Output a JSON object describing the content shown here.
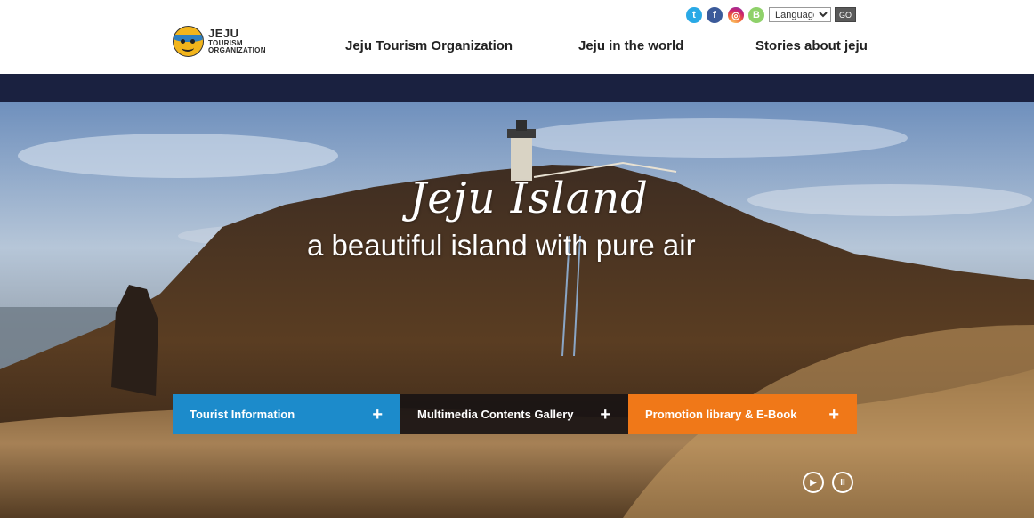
{
  "header": {
    "logo": {
      "line1": "JEJU",
      "line2": "TOURISM",
      "line3": "ORGANIZATION"
    },
    "nav": [
      {
        "label": "Jeju Tourism Organization"
      },
      {
        "label": "Jeju in the world"
      },
      {
        "label": "Stories about jeju"
      }
    ],
    "social": [
      {
        "icon": "twitter-icon",
        "glyph": "t",
        "color": "#29a9e6"
      },
      {
        "icon": "facebook-icon",
        "glyph": "f",
        "color": "#3b5a9a"
      },
      {
        "icon": "instagram-icon",
        "glyph": "◎",
        "color": "#c9236f"
      },
      {
        "icon": "blog-icon",
        "glyph": "B",
        "color": "#8fd16a"
      }
    ],
    "language_select": {
      "selected": "Language"
    },
    "go_label": "GO"
  },
  "hero": {
    "title": "Jeju Island",
    "subtitle": "a beautiful island with pure air",
    "tiles": [
      {
        "label": "Tourist Information",
        "color": "#1c8bcb"
      },
      {
        "label": "Multimedia Contents Gallery",
        "color": "#191414"
      },
      {
        "label": "Promotion library & E-Book",
        "color": "#f07818"
      }
    ],
    "plus_glyph": "+",
    "play_glyph": "▶",
    "pause_glyph": "II"
  },
  "colors": {
    "navy_bar": "#1a2140"
  }
}
